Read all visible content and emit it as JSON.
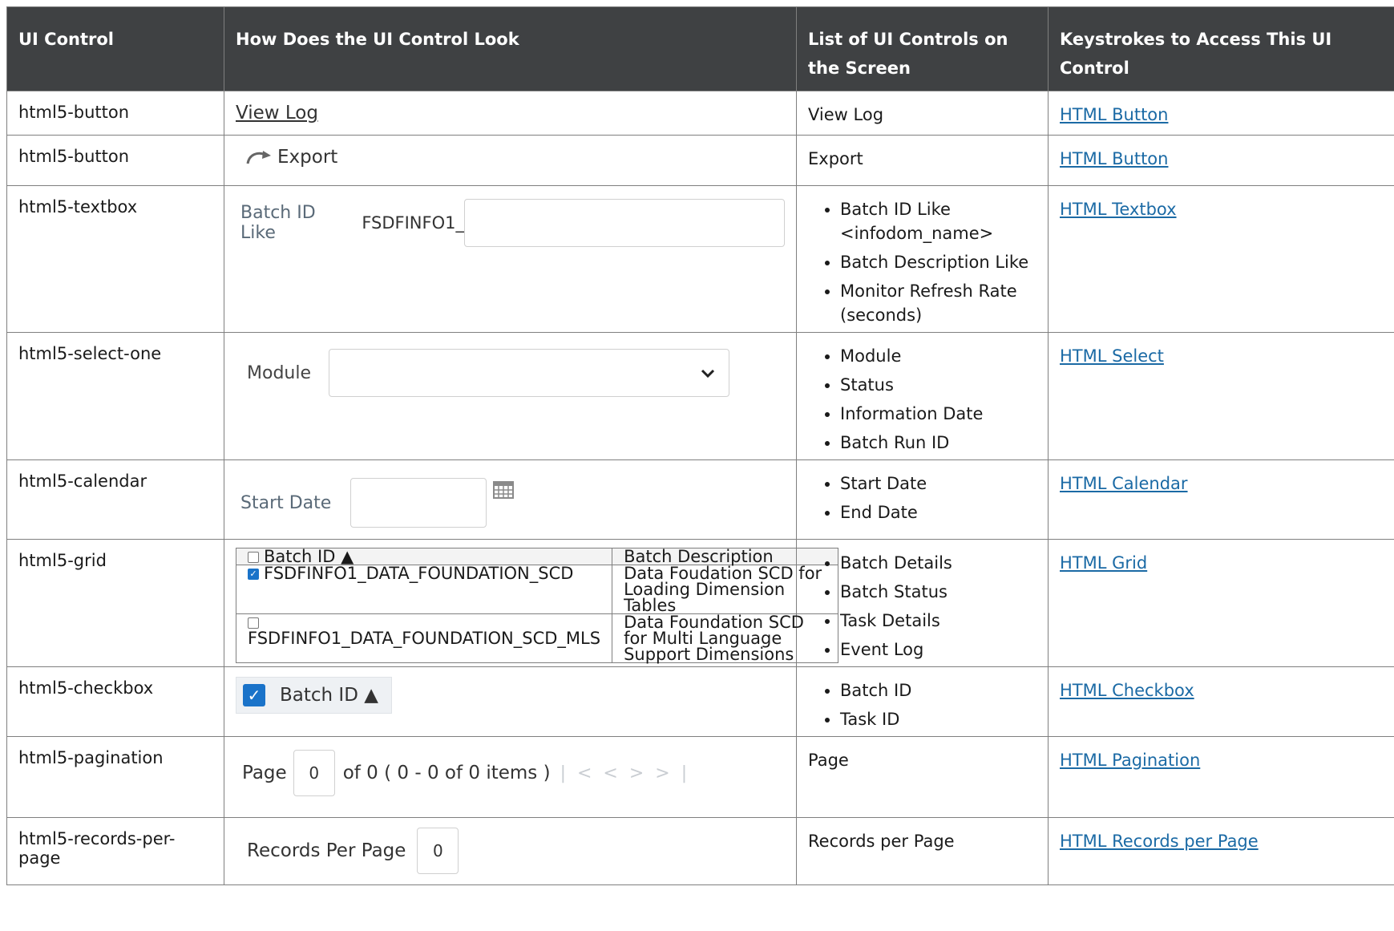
{
  "headers": [
    "UI Control",
    "How Does the UI Control Look",
    "List of UI Controls on the Screen",
    "Keystrokes to Access This UI Control"
  ],
  "rows": [
    {
      "control": "html5-button",
      "list_text": "View Log",
      "link": "HTML Button"
    },
    {
      "control": "html5-button",
      "list_text": "Export",
      "link": "HTML Button"
    },
    {
      "control": "html5-textbox",
      "list": [
        "Batch ID Like <infodom_name>",
        "Batch Description Like",
        "Monitor Refresh Rate (seconds)"
      ],
      "link": "HTML Textbox"
    },
    {
      "control": "html5-select-one",
      "list": [
        "Module",
        "Status",
        "Information Date",
        "Batch Run ID"
      ],
      "link": "HTML Select"
    },
    {
      "control": "html5-calendar",
      "list": [
        "Start Date",
        "End Date"
      ],
      "link": "HTML Calendar"
    },
    {
      "control": "html5-grid",
      "list": [
        "Batch Details",
        "Batch Status",
        "Task Details",
        "Event Log"
      ],
      "link": "HTML Grid"
    },
    {
      "control": "html5-checkbox",
      "list": [
        "Batch ID",
        "Task ID"
      ],
      "link": "HTML Checkbox"
    },
    {
      "control": "html5-pagination",
      "list_text": "Page",
      "link": "HTML Pagination"
    },
    {
      "control": "html5-records-per-page",
      "list_text": "Records per Page",
      "link": "HTML Records per Page"
    }
  ],
  "mock": {
    "viewlog": "View Log",
    "export": "Export",
    "textbox_label": "Batch ID Like",
    "textbox_prefix": "FSDFINFO1_",
    "select_label": "Module",
    "calendar_label": "Start Date",
    "grid": {
      "col1": "Batch ID ▲",
      "col2": "Batch Description",
      "rows": [
        {
          "id": "FSDFINFO1_DATA_FOUNDATION_SCD",
          "desc": "Data Foudation SCD for Loading Dimension Tables",
          "checked": true
        },
        {
          "id": "FSDFINFO1_DATA_FOUNDATION_SCD_MLS",
          "desc": "Data Foundation SCD for Multi Language Support Dimensions",
          "checked": false
        }
      ]
    },
    "checkbox_label": "Batch ID ▲",
    "page_label": "Page",
    "page_value": "0",
    "page_of": "of 0 ( 0 - 0 of 0 items )",
    "rpp_label": "Records Per Page",
    "rpp_value": "0"
  },
  "colors": {
    "header_bg": "#3f4143",
    "link": "#1b6aa5",
    "accent": "#1a73c9"
  }
}
